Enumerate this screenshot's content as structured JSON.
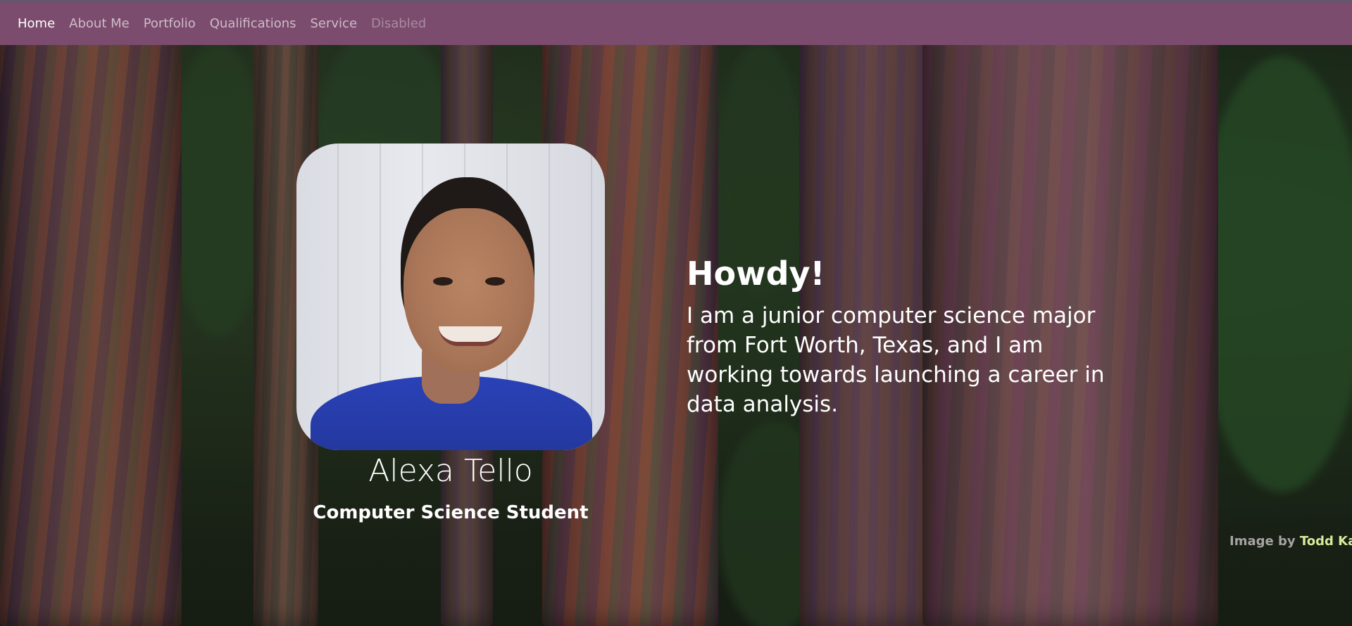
{
  "nav": {
    "items": [
      {
        "label": "Home",
        "state": "active"
      },
      {
        "label": "About Me",
        "state": "normal"
      },
      {
        "label": "Portfolio",
        "state": "normal"
      },
      {
        "label": "Qualifications",
        "state": "normal"
      },
      {
        "label": "Service",
        "state": "normal"
      },
      {
        "label": "Disabled",
        "state": "disabled"
      }
    ]
  },
  "profile": {
    "name": "Alexa Tello",
    "role": "Computer Science Student"
  },
  "intro": {
    "heading": "Howdy!",
    "text": "I am a junior computer science major from Fort Worth, Texas, and I am working towards launching a career in data analysis."
  },
  "credit": {
    "prefix": "Image by",
    "author": "Todd Kay"
  },
  "colors": {
    "navbar": "#7b4c6e",
    "nav_active": "#ffffff",
    "credit_link": "#d6ec9b"
  }
}
